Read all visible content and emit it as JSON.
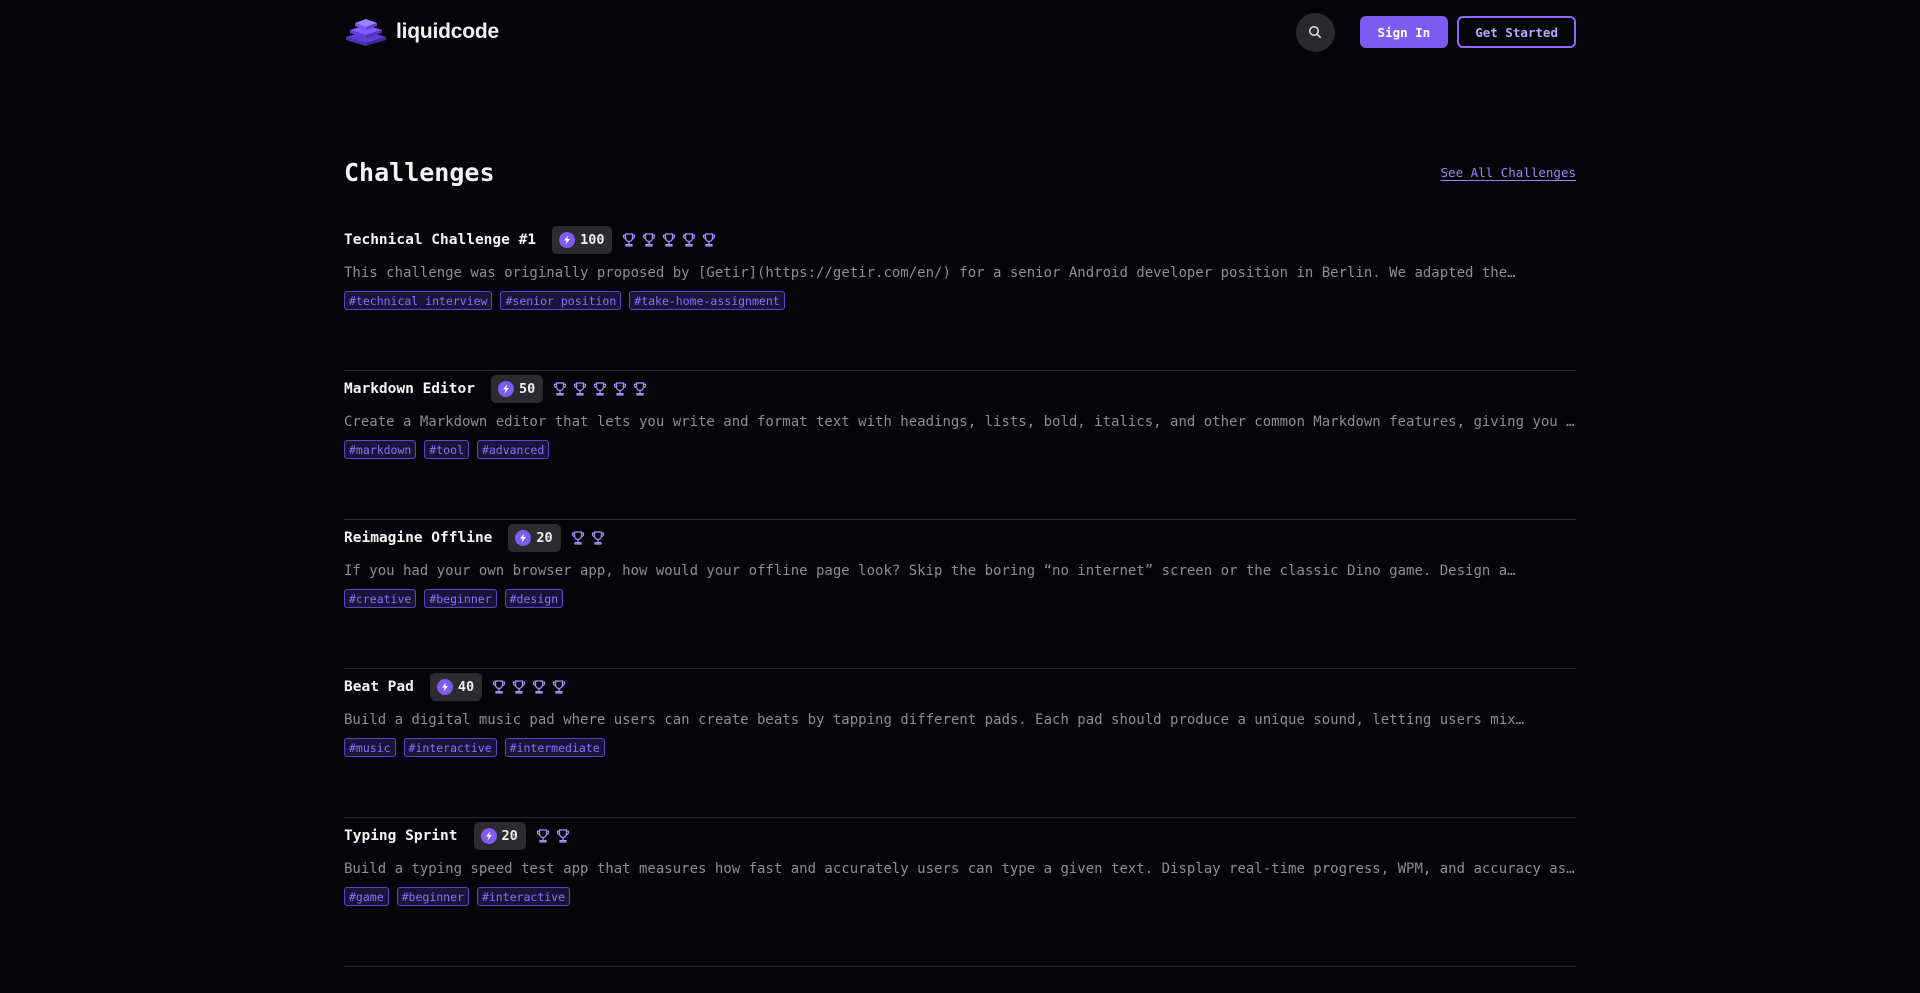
{
  "brand": {
    "name": "liquidcode"
  },
  "header": {
    "search_icon": "search-icon",
    "sign_in_label": "Sign In",
    "get_started_label": "Get Started"
  },
  "section": {
    "title": "Challenges",
    "see_all_label": "See All Challenges"
  },
  "colors": {
    "background": "#050507",
    "accent": "#7c5cf5",
    "tag_text": "#8a70ff"
  },
  "challenges": [
    {
      "title": "Technical Challenge #1",
      "points": "100",
      "trophies": 5,
      "description": "This challenge was originally proposed by [Getir](https://getir.com/en/) for a senior Android developer position in Berlin. We adapted the…",
      "tags": [
        "#technical interview",
        "#senior position",
        "#take-home-assignment"
      ]
    },
    {
      "title": "Markdown Editor",
      "points": "50",
      "trophies": 5,
      "description": "Create a Markdown editor that lets you write and format text with headings, lists, bold, italics, and other common Markdown features, giving you …",
      "tags": [
        "#markdown",
        "#tool",
        "#advanced"
      ]
    },
    {
      "title": "Reimagine Offline",
      "points": "20",
      "trophies": 2,
      "description": "If you had your own browser app, how would your offline page look? Skip the boring “no internet” screen or the classic Dino game. Design a…",
      "tags": [
        "#creative",
        "#beginner",
        "#design"
      ]
    },
    {
      "title": "Beat Pad",
      "points": "40",
      "trophies": 4,
      "description": "Build a digital music pad where users can create beats by tapping different pads. Each pad should produce a unique sound, letting users mix…",
      "tags": [
        "#music",
        "#interactive",
        "#intermediate"
      ]
    },
    {
      "title": "Typing Sprint",
      "points": "20",
      "trophies": 2,
      "description": "Build a typing speed test app that measures how fast and accurately users can type a given text. Display real-time progress, WPM, and accuracy as…",
      "tags": [
        "#game",
        "#beginner",
        "#interactive"
      ]
    }
  ]
}
